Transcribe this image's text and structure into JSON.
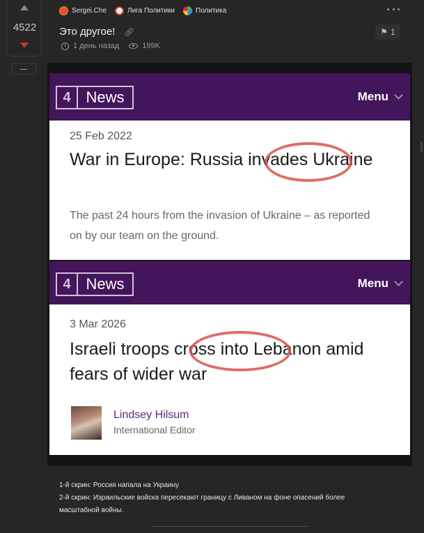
{
  "vote": {
    "count": "4522"
  },
  "post": {
    "author": "Sergei.Che",
    "communities": [
      "Лига Политики",
      "Политика"
    ],
    "title": "Это другое!",
    "comments_count": "1",
    "time": "1 день назад",
    "views": "199K"
  },
  "screens": [
    {
      "logo_digit": "4",
      "logo_text": "News",
      "menu_label": "Menu",
      "date": "25 Feb 2022",
      "headline": "War in Europe: Russia invades Ukraine",
      "summary": "The past 24 hours from the invasion of Ukraine – as reported on by our team on the ground."
    },
    {
      "logo_digit": "4",
      "logo_text": "News",
      "menu_label": "Menu",
      "date": "3 Mar 2026",
      "headline": "Israeli troops cross into Lebanon amid fears of wider war",
      "author_name": "Lindsey Hilsum",
      "author_role": "International Editor"
    }
  ],
  "caption": {
    "line1": "1-й скрин: Россия напала на Украину",
    "line2": "2-й скрин: Израильские войска пересекают границу с Ливаном на фоне опасений более масштабной войны."
  },
  "colors": {
    "news_purple": "#43155b",
    "highlight_circle": "#d9534f",
    "downvote": "#c0392b"
  },
  "icons": [
    "upvote-icon",
    "downvote-icon",
    "collapse-icon",
    "more-icon",
    "link-icon",
    "comments-icon",
    "clock-icon",
    "eye-icon"
  ]
}
